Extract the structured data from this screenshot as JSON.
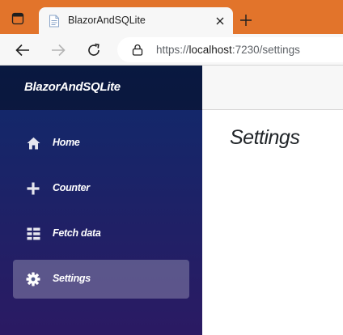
{
  "browser": {
    "tab": {
      "title": "BlazorAndSQLite",
      "close_icon": "close-icon",
      "favicon": "page-icon"
    },
    "address": {
      "scheme": "https://",
      "host": "localhost",
      "rest": ":7230/settings"
    },
    "colors": {
      "tabstrip": "#e2742b",
      "toolbar": "#f7f7f7"
    }
  },
  "app": {
    "brand": "BlazorAndSQLite",
    "nav": [
      {
        "label": "Home",
        "icon": "home-icon",
        "active": false
      },
      {
        "label": "Counter",
        "icon": "plus-icon",
        "active": false
      },
      {
        "label": "Fetch data",
        "icon": "list-icon",
        "active": false
      },
      {
        "label": "Settings",
        "icon": "gear-icon",
        "active": true
      }
    ],
    "page_title": "Settings",
    "colors": {
      "sidebar_top": "#0f2a6b",
      "sidebar_bottom": "#2b1a63"
    }
  }
}
